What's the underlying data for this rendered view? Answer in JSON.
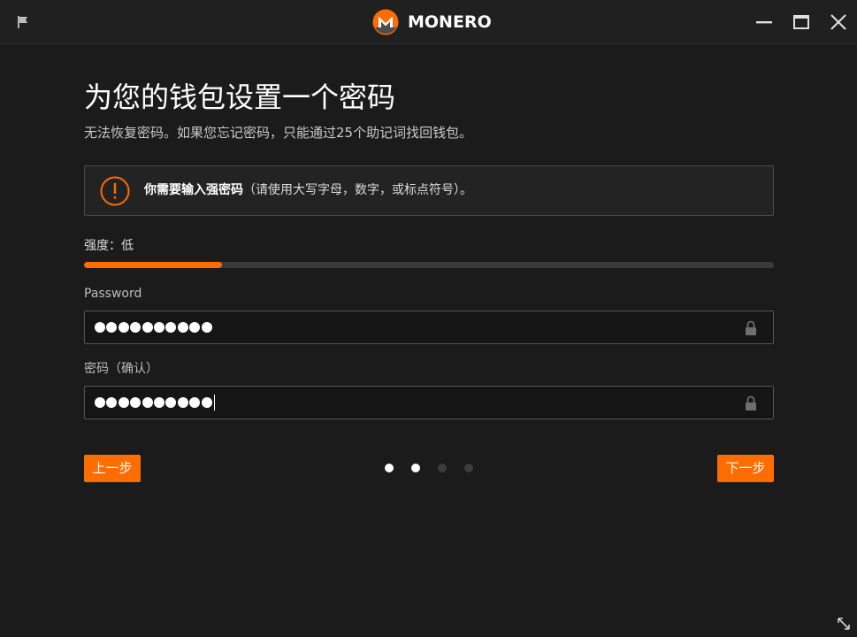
{
  "app": {
    "brand_name": "MONERO",
    "brand_color": "#ff6c00"
  },
  "titlebar": {
    "icons": [
      "flag-icon",
      "minimize-icon",
      "maximize-icon",
      "close-icon"
    ]
  },
  "page": {
    "title": "为您的钱包设置一个密码",
    "subtitle": "无法恢复密码。如果您忘记密码，只能通过25个助记词找回钱包。"
  },
  "warning": {
    "icon": "exclamation-circle-icon",
    "bold_text": "你需要输入强密码",
    "text": "（请使用大写字母，数字，或标点符号）。"
  },
  "strength": {
    "label": "强度：低",
    "level_percent": 20
  },
  "password": {
    "label": "Password",
    "masked_length": 10
  },
  "confirm": {
    "label": "密码（确认）",
    "masked_length": 10
  },
  "nav": {
    "prev_label": "上一步",
    "next_label": "下一步",
    "steps_total": 4,
    "steps_active": 2
  },
  "colors": {
    "background": "#1b1b1b",
    "accent": "#ff6c00",
    "dot_active": "#ffffff",
    "dot_inactive": "#3c3c3c"
  }
}
